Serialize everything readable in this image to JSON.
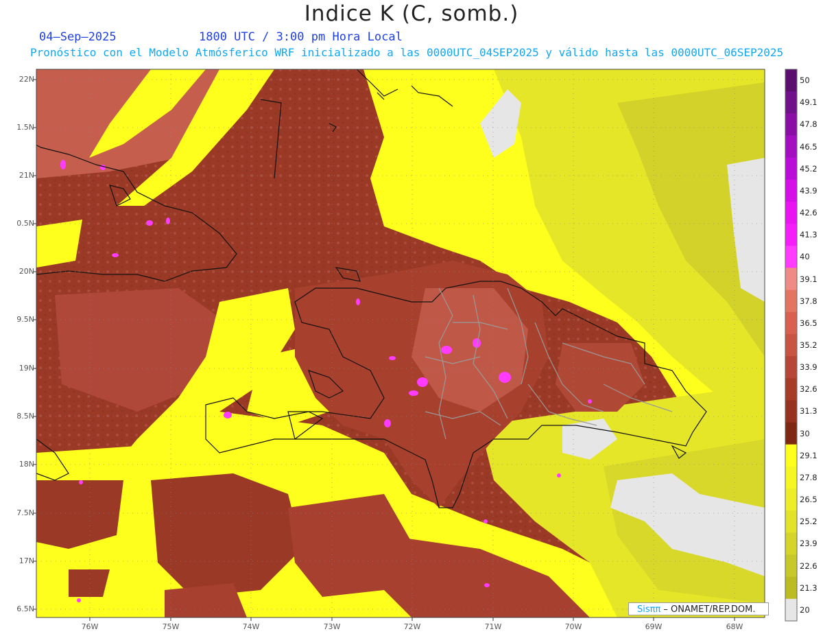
{
  "header": {
    "title": "Indice K (C, somb.)",
    "date": "04–Sep–2025",
    "time": "1800 UTC / 3:00 pm Hora Local",
    "description": "Pronóstico con el Modelo Atmósferico WRF inicializado a las 0000UTC_04SEP2025 y válido hasta las  0000UTC_06SEP2025"
  },
  "map": {
    "lat_labels": [
      "22N",
      "1.5N",
      "21N",
      "0.5N",
      "20N",
      "9.5N",
      "19N",
      "8.5N",
      "18N",
      "7.5N",
      "17N",
      "6.5N"
    ],
    "lon_labels": [
      "76W",
      "75W",
      "74W",
      "73W",
      "72W",
      "71W",
      "70W",
      "69W",
      "68W"
    ]
  },
  "colorbar": {
    "levels": [
      "50",
      "49.1",
      "47.8",
      "46.5",
      "45.2",
      "43.9",
      "42.6",
      "41.3",
      "40",
      "39.1",
      "37.8",
      "36.5",
      "35.2",
      "33.9",
      "32.6",
      "31.3",
      "30",
      "29.1",
      "27.8",
      "26.5",
      "25.2",
      "23.9",
      "22.6",
      "21.3",
      "20"
    ],
    "colors": [
      "#5a0f6e",
      "#70108a",
      "#8a0ea6",
      "#a20ec0",
      "#ba0ed8",
      "#d40fe8",
      "#e815f2",
      "#f41ff8",
      "#ff3bff",
      "#f08a84",
      "#e47462",
      "#d86050",
      "#c85444",
      "#b84636",
      "#a83a28",
      "#96321e",
      "#7e2814",
      "#ffff1e",
      "#f6f622",
      "#eded28",
      "#e2e22a",
      "#d4d42a",
      "#c8c82a",
      "#bcbc22",
      "#e6e6e6"
    ]
  },
  "credit": {
    "brand_prefix": "Sis",
    "brand_symbol": "ππ",
    "text": " – ONAMET/REP.DOM."
  }
}
